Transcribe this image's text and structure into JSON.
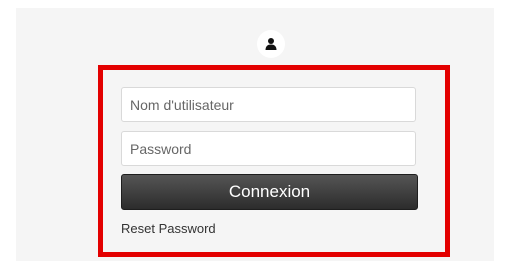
{
  "login": {
    "username_placeholder": "Nom d'utilisateur",
    "password_placeholder": "Password",
    "submit_label": "Connexion",
    "reset_label": "Reset Password"
  },
  "icons": {
    "avatar": "user-icon"
  },
  "colors": {
    "highlight_border": "#e30000",
    "button_top": "#555555",
    "button_bottom": "#2c2c2c",
    "panel_background": "#f5f5f5"
  }
}
